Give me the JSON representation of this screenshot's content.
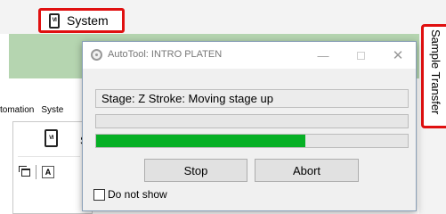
{
  "app": {
    "system_label": "System",
    "system_icon_text": "VI",
    "sample_transfer_label": "Sample Transfer",
    "tabs": [
      "tomation",
      "Syste"
    ],
    "panel_letter": "S",
    "font_tool_glyph": "A"
  },
  "dialog": {
    "title": "AutoTool: INTRO PLATEN",
    "minimize_glyph": "—",
    "close_glyph": "✕",
    "status_text": "Stage: Z Stroke: Moving stage up",
    "progress_overall": 0.0,
    "progress_step": 0.67,
    "progress_color": "#06b025",
    "stop_label": "Stop",
    "abort_label": "Abort",
    "do_not_show_label": "Do not show",
    "do_not_show_checked": false
  },
  "colors": {
    "highlight_red": "#e01010",
    "toolbar_green": "#b5d5b0"
  }
}
